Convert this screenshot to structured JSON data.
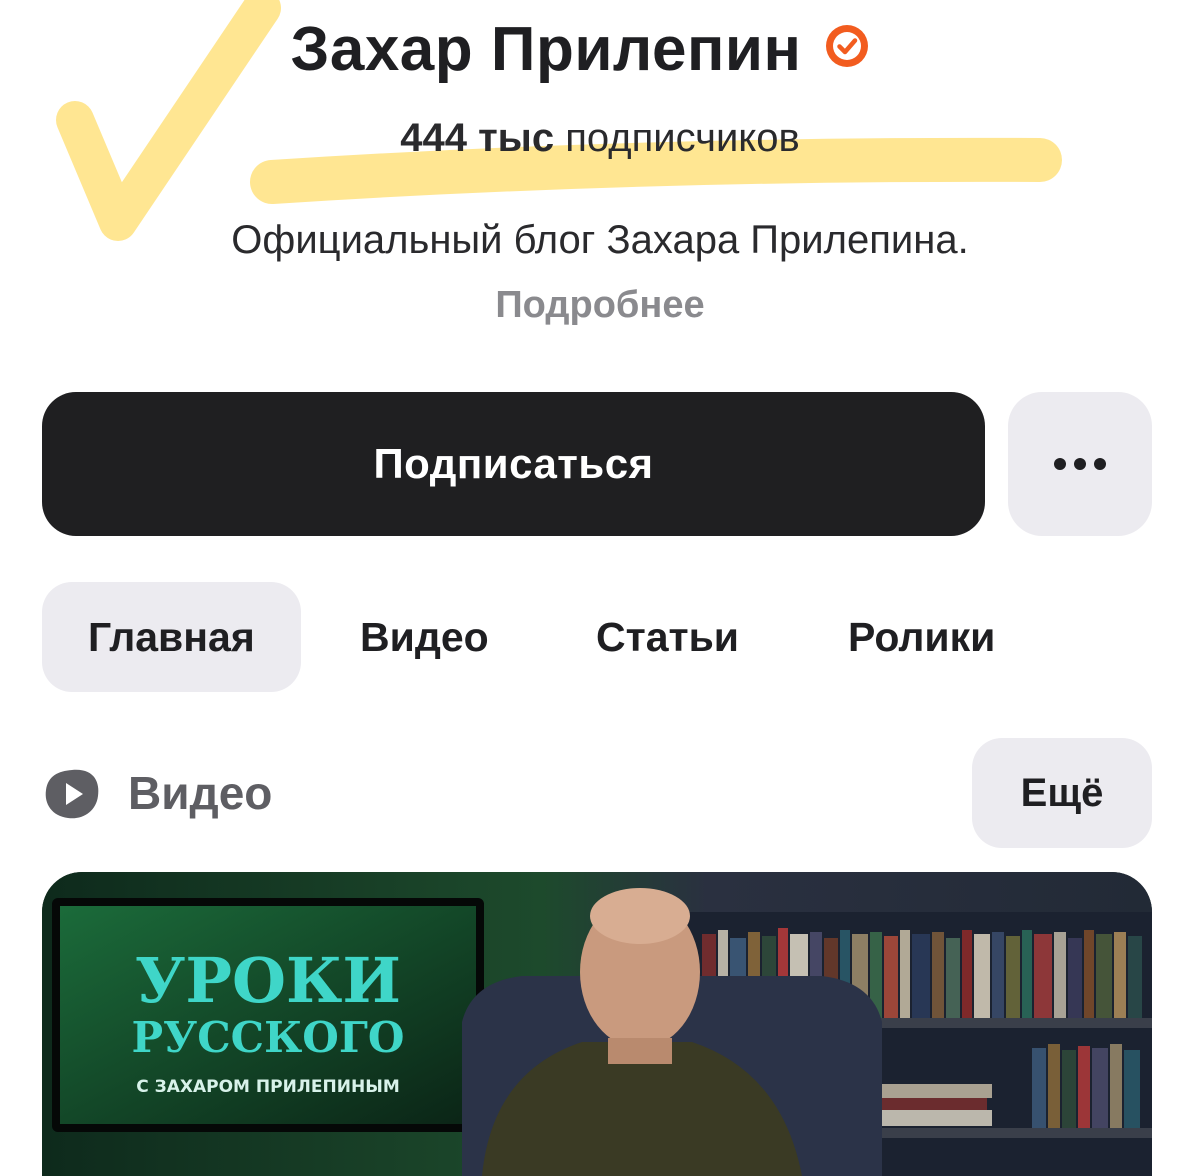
{
  "channel": {
    "name": "Захар Прилепин",
    "verified": true,
    "subscribers_count": "444 тыс",
    "subscribers_label": "подписчиков",
    "description": "Официальный блог Захара Прилепина.",
    "more_link": "Подробнее"
  },
  "actions": {
    "subscribe_label": "Подписаться",
    "more_icon": "ellipsis-icon"
  },
  "tabs": [
    {
      "label": "Главная",
      "active": true
    },
    {
      "label": "Видео",
      "active": false
    },
    {
      "label": "Статьи",
      "active": false
    },
    {
      "label": "Ролики",
      "active": false
    }
  ],
  "video_section": {
    "title": "Видео",
    "icon": "video-play-icon",
    "more_label": "Ещё"
  },
  "video_thumbnail": {
    "title_line1": "УРОКИ",
    "title_line2": "РУССКОГО",
    "subtitle": "С ЗАХАРОМ ПРИЛЕПИНЫМ"
  },
  "colors": {
    "accent_verified": "#f25c1f",
    "highlighter": "#ffe07a",
    "button_dark": "#1f1f21",
    "button_light": "#ecebf0",
    "thumb_title": "#3fd6c8"
  }
}
